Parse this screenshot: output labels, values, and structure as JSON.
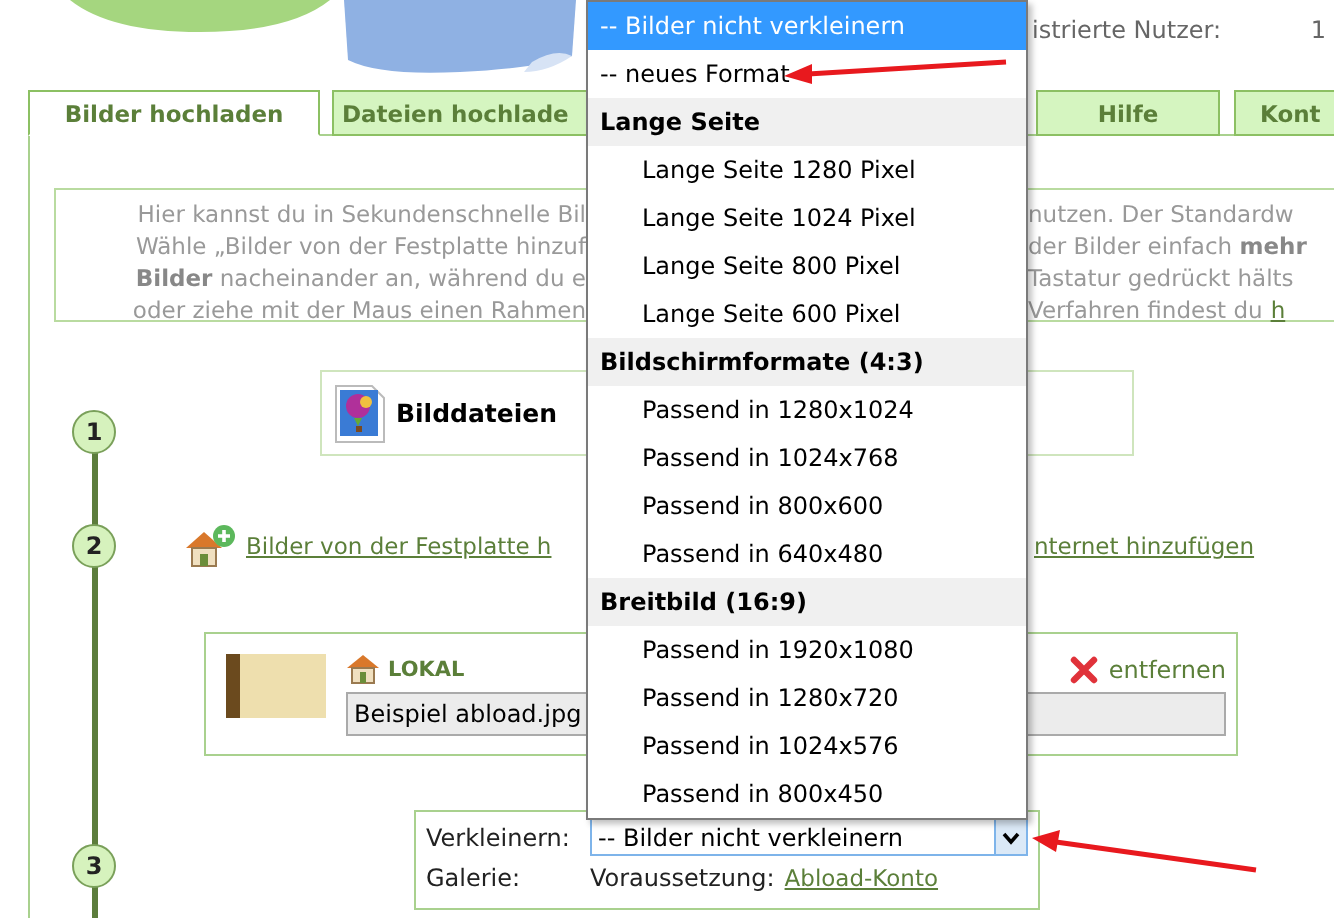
{
  "header": {
    "stats": [
      {
        "label": "istrierte Nutzer:",
        "value": "1"
      }
    ]
  },
  "tabs": [
    {
      "label": "Bilder hochladen",
      "selected": true
    },
    {
      "label": "Dateien hochlade",
      "selected": false
    },
    {
      "label": "Hilfe",
      "selected": false
    },
    {
      "label": "Kont",
      "selected": false
    }
  ],
  "intro": {
    "lines": [
      {
        "left": "Hier kannst du in Sekundenschnelle Bil",
        "right": "nutzen. Der Standardw"
      },
      {
        "left": "Wähle „Bilder von der Festplatte hinzuf",
        "right": "der Bilder einfach **mehr**"
      },
      {
        "left": "**Bilder** nacheinander an, während du e",
        "right": "Tastatur gedrückt hälts"
      },
      {
        "left": "oder ziehe mit der Maus einen Rahmen",
        "right": "Verfahren findest du",
        "link": "h"
      }
    ]
  },
  "steps": [
    {
      "number": "1"
    },
    {
      "number": "2"
    },
    {
      "number": "3"
    }
  ],
  "file_source": {
    "label": "Bilddateien"
  },
  "add_link": {
    "left": "Bilder von der Festplatte h",
    "right": "nternet hinzufügen"
  },
  "local_file": {
    "source": "LOKAL",
    "filename": "Beispiel abload.jpg",
    "remove": "entfernen"
  },
  "options_box": {
    "resize_label": "Verkleinern:",
    "resize_value": "-- Bilder nicht verkleinern",
    "gallery_label": "Galerie:",
    "requirement": "Voraussetzung:",
    "requirement_link": "Abload-Konto"
  },
  "dropdown": {
    "items": [
      {
        "kind": "option",
        "label": "-- Bilder nicht verkleinern",
        "selected": true
      },
      {
        "kind": "option",
        "label": "-- neues Format",
        "selected": false
      },
      {
        "kind": "group",
        "label": "Lange Seite",
        "options": [
          {
            "label": "Lange Seite 1280 Pixel",
            "selected": false
          },
          {
            "label": "Lange Seite 1024 Pixel",
            "selected": false
          },
          {
            "label": "Lange Seite 800 Pixel",
            "selected": false
          },
          {
            "label": "Lange Seite 600 Pixel",
            "selected": false
          }
        ]
      },
      {
        "kind": "group",
        "label": "Bildschirmformate (4:3)",
        "options": [
          {
            "label": "Passend in 1280x1024",
            "selected": false
          },
          {
            "label": "Passend in 1024x768",
            "selected": false
          },
          {
            "label": "Passend in 800x600",
            "selected": false
          },
          {
            "label": "Passend in 640x480",
            "selected": false
          }
        ]
      },
      {
        "kind": "group",
        "label": "Breitbild (16:9)",
        "options": [
          {
            "label": "Passend in 1920x1080",
            "selected": false
          },
          {
            "label": "Passend in 1280x720",
            "selected": false
          },
          {
            "label": "Passend in 1024x576",
            "selected": false
          },
          {
            "label": "Passend in 800x450",
            "selected": false
          }
        ]
      }
    ]
  }
}
